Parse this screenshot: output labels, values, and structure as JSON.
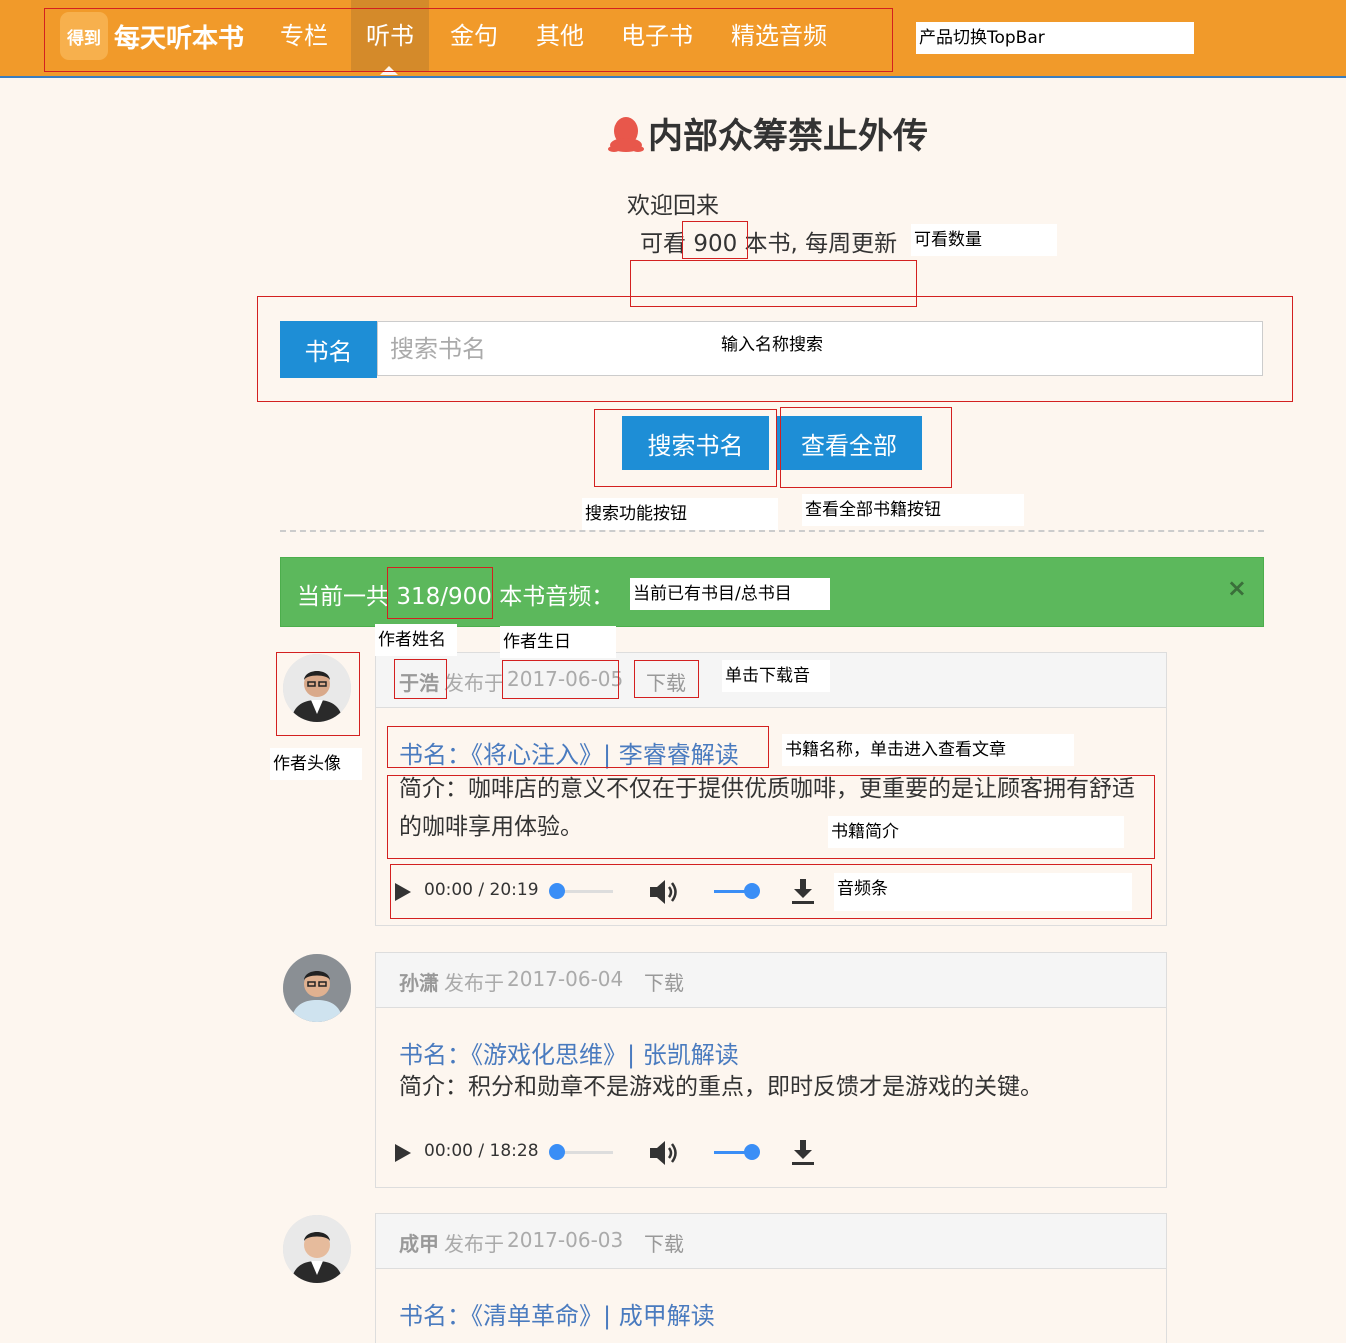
{
  "topbar": {
    "logo_text": "得到",
    "brand": "每天听本书",
    "nav": [
      "专栏",
      "听书",
      "金句",
      "其他",
      "电子书",
      "精选音频"
    ],
    "active_index": 1
  },
  "header": {
    "title": "内部众筹禁止外传",
    "welcome": "欢迎回来",
    "available_prefix": "可看",
    "available_count": "900",
    "available_suffix": "本书, 每周更新"
  },
  "search": {
    "label": "书名",
    "placeholder": "搜索书名",
    "search_button": "搜索书名",
    "view_all_button": "查看全部"
  },
  "summary": {
    "prefix": "当前一共",
    "count": "318/900",
    "suffix": "本书音频：",
    "close": "×"
  },
  "entries": [
    {
      "author": "于浩",
      "published_label": "发布于",
      "date": "2017-06-05",
      "download": "下载",
      "book": "书名：《将心注入》| 李睿睿解读",
      "intro": "简介：咖啡店的意义不仅在于提供优质咖啡，更重要的是让顾客拥有舒适的咖啡享用体验。",
      "time_current": "00:00",
      "time_total": "20:19"
    },
    {
      "author": "孙潇",
      "published_label": "发布于",
      "date": "2017-06-04",
      "download": "下载",
      "book": "书名：《游戏化思维》| 张凯解读",
      "intro": "简介：积分和勋章不是游戏的重点，即时反馈才是游戏的关键。",
      "time_current": "00:00",
      "time_total": "18:28"
    },
    {
      "author": "成甲",
      "published_label": "发布于",
      "date": "2017-06-03",
      "download": "下载",
      "book": "书名：《清单革命》| 成甲解读",
      "intro": "",
      "time_current": "",
      "time_total": ""
    }
  ],
  "annotations": {
    "topbar": "产品切换TopBar",
    "count": "可看数量",
    "search_input": "输入名称搜索",
    "search_btn": "搜索功能按钮",
    "view_all_btn": "查看全部书籍按钮",
    "books_count": "当前已有书目/总书目",
    "author_name": "作者姓名",
    "author_birthday": "作者生日",
    "download": "单击下载音",
    "avatar": "作者头像",
    "book_name": "书籍名称，单击进入查看文章",
    "book_intro": "书籍简介",
    "audio_bar": "音频条"
  },
  "colors": {
    "topbar": "#f19a2a",
    "primary_button": "#1e8ed6",
    "success_bar": "#5cb85c",
    "link": "#4a7bbf",
    "annotation_border": "#d32020"
  }
}
